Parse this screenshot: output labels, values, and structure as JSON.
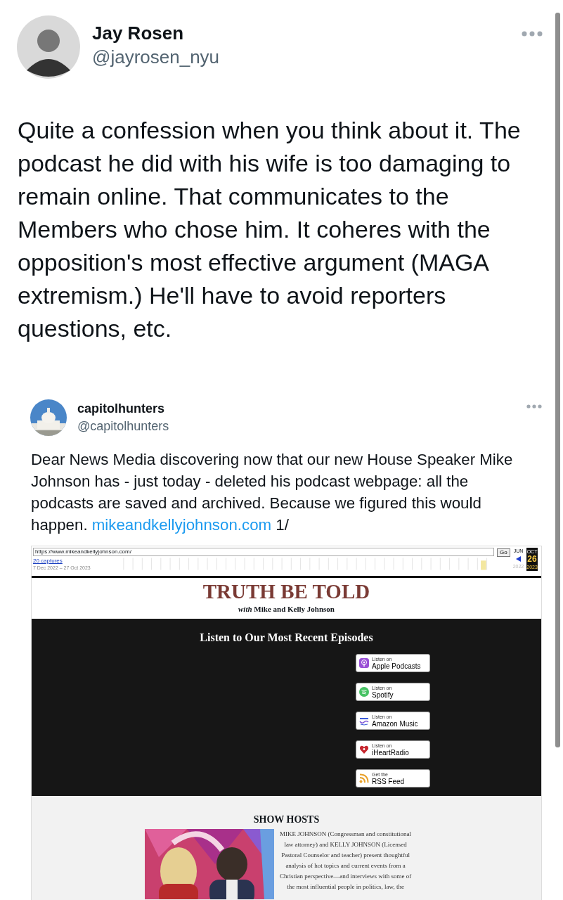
{
  "tweet": {
    "author": {
      "name": "Jay Rosen",
      "handle": "@jayrosen_nyu"
    },
    "text": "Quite a confession when you think about it. The podcast he did with his wife is too damaging to remain online. That communicates to the Members who chose him. It coheres with the opposition's most effective argument (MAGA extremism.) He'll have to avoid reporters questions, etc."
  },
  "quoted": {
    "author": {
      "name": "capitolhunters",
      "handle": "@capitolhunters"
    },
    "text": "Dear News Media discovering now that our new House Speaker Mike Johnson has - just today - deleted his podcast webpage: all the podcasts are saved and archived. Because we figured this would happen. ",
    "link": "mikeandkellyjohnson.com",
    "suffix": " 1/"
  },
  "screenshot": {
    "archive": {
      "url": "https://www.mikeandkellyjohnson.com/",
      "go": "Go",
      "captures": "20 captures",
      "range": "7 Dec 2022 – 27 Oct 2023",
      "prev_month": "JUN",
      "month": "OCT",
      "day": "26",
      "prev_year": "2022",
      "year": "2023"
    },
    "site": {
      "title": "TRUTH BE TOLD",
      "subtitle": "*with* Mike and Kelly Johnson",
      "episodes_heading": "Listen to Our Most Recent Episodes",
      "platforms": [
        {
          "kind": "apple",
          "kicker": "Listen on",
          "name": "Apple Podcasts"
        },
        {
          "kind": "spotify",
          "kicker": "Listen on",
          "name": "Spotify"
        },
        {
          "kind": "amazon",
          "kicker": "Listen on",
          "name": "Amazon Music"
        },
        {
          "kind": "iheart",
          "kicker": "Listen on",
          "name": "iHeartRadio"
        },
        {
          "kind": "rss",
          "kicker": "Get the",
          "name": "RSS Feed"
        }
      ],
      "hosts_heading": "SHOW HOSTS",
      "hosts_text": "MIKE JOHNSON (Congressman and constitutional\nlaw attorney) and KELLY JOHNSON (Licensed\nPastoral Counselor and teacher) present thoughtful\nanalysis of hot topics and current events from a\nChristian perspective—and interviews with some of\nthe most influential people in politics, law, the"
    }
  }
}
